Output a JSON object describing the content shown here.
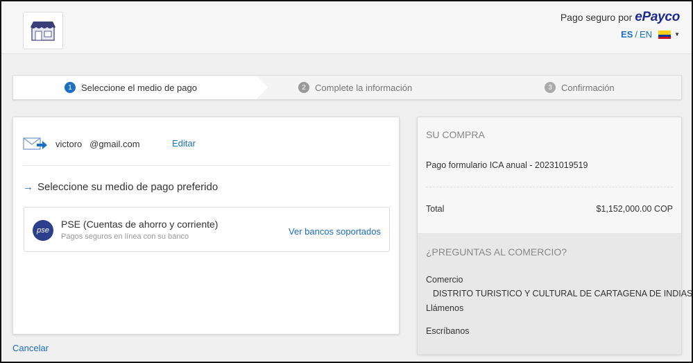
{
  "header": {
    "secure_prefix": "Pago seguro por",
    "brand": "ePayco",
    "lang_es": "ES",
    "lang_sep": "/",
    "lang_en": "EN",
    "flag_colors": [
      "#fcd116",
      "#003893",
      "#ce1126"
    ]
  },
  "steps": [
    {
      "num": "1",
      "label": "Seleccione el medio de pago"
    },
    {
      "num": "2",
      "label": "Complete la información"
    },
    {
      "num": "3",
      "label": "Confirmación"
    }
  ],
  "left": {
    "email": "victoro   @gmail.com",
    "edit_label": "Editar",
    "select_title": "Seleccione su medio de pago preferido",
    "pse": {
      "logo_text": "pse",
      "title": "PSE (Cuentas de ahorro y corriente)",
      "subtitle": "Pagos seguros en línea con su banco",
      "link": "Ver bancos soportados"
    },
    "cancel_label": "Cancelar"
  },
  "right": {
    "heading": "SU COMPRA",
    "description": "Pago formulario ICA anual - 20231019519",
    "total_label": "Total",
    "total_value": "$1,152,000.00 COP",
    "questions_heading": "¿PREGUNTAS AL COMERCIO?",
    "comercio_label": "Comercio",
    "comercio_name": "DISTRITO TURISTICO Y CULTURAL DE CARTAGENA DE INDIAS",
    "llamenos": "Llámenos",
    "escribanos": "Escríbanos"
  },
  "colors": {
    "accent": "#1c6fc2",
    "brand": "#1f2b8f"
  }
}
